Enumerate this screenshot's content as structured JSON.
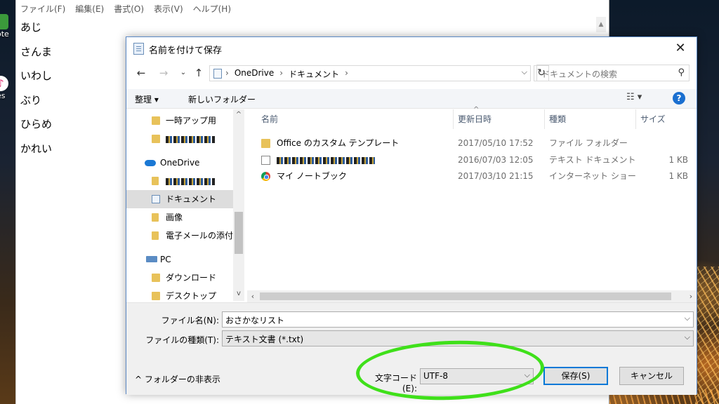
{
  "desktop": {
    "icons": [
      {
        "label": "note"
      },
      {
        "label": "nes"
      }
    ]
  },
  "notepad": {
    "menu": [
      "ファイル(F)",
      "編集(E)",
      "書式(O)",
      "表示(V)",
      "ヘルプ(H)"
    ],
    "lines": [
      "あじ",
      "さんま",
      "いわし",
      "ぶり",
      "ひらめ",
      "かれい"
    ]
  },
  "dialog": {
    "title": "名前を付けて保存",
    "close": "✕",
    "address": {
      "crumbs": [
        "OneDrive",
        "ドキュメント"
      ]
    },
    "search": {
      "placeholder": "ドキュメントの検索"
    },
    "toolbar": {
      "organize": "整理 ▾",
      "new_folder": "新しいフォルダー",
      "help": "?"
    },
    "nav_pane": [
      {
        "label": "一時アップ用",
        "icon": "folder-sync-icon"
      },
      {
        "label": "",
        "icon": "folder-sync-icon",
        "redacted": true
      },
      {
        "label": "OneDrive",
        "icon": "onedrive-cloud-icon"
      },
      {
        "label": "",
        "icon": "folder-icon",
        "redacted": true
      },
      {
        "label": "ドキュメント",
        "icon": "documents-folder-icon",
        "selected": true
      },
      {
        "label": "画像",
        "icon": "folder-icon"
      },
      {
        "label": "電子メールの添付フ",
        "icon": "folder-icon"
      },
      {
        "label": "PC",
        "icon": "pc-icon"
      },
      {
        "label": "ダウンロード",
        "icon": "downloads-folder-icon"
      },
      {
        "label": "デスクトップ",
        "icon": "desktop-folder-icon"
      }
    ],
    "columns": [
      "名前",
      "更新日時",
      "種類",
      "サイズ"
    ],
    "files": [
      {
        "name": "Office のカスタム テンプレート",
        "modified": "2017/05/10 17:52",
        "type": "ファイル フォルダー",
        "size": "",
        "icon": "folder-icon"
      },
      {
        "name": "",
        "redacted": true,
        "modified": "2016/07/03 12:05",
        "type": "テキスト ドキュメント",
        "size": "1 KB",
        "icon": "text-file-icon"
      },
      {
        "name": "マイ ノートブック",
        "modified": "2017/03/10 21:15",
        "type": "インターネット ショート...",
        "size": "1 KB",
        "icon": "chrome-shortcut-icon"
      }
    ],
    "form": {
      "filename_label": "ファイル名(N):",
      "filename_value": "おさかなリスト",
      "filetype_label": "ファイルの種類(T):",
      "filetype_value": "テキスト文書 (*.txt)",
      "encoding_label": "文字コード(E):",
      "encoding_value": "UTF-8",
      "save": "保存(S)",
      "cancel": "キャンセル",
      "hide_folders": "フォルダーの非表示"
    }
  },
  "colors": {
    "highlight": "#3fe01a",
    "accent": "#0078d7",
    "help": "#1a6fd0"
  }
}
